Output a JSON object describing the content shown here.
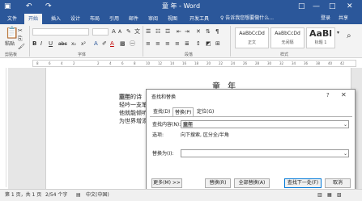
{
  "app": {
    "title": "童 年 - Word",
    "quick_access": {
      "save_icon": "save-icon",
      "undo_icon": "undo-icon",
      "redo_icon": "redo-icon"
    },
    "window_controls": {
      "restore_ribbon": "□",
      "minimize": "—",
      "maximize": "□",
      "close": "✕"
    }
  },
  "tabs": [
    "文件",
    "开始",
    "插入",
    "设计",
    "布局",
    "引用",
    "邮件",
    "审阅",
    "视图",
    "开发工具"
  ],
  "active_tab": 1,
  "tellme": "♀ 告诉我您想要做什么...",
  "account": {
    "signin": "登录",
    "share": "共享"
  },
  "ribbon": {
    "paste_label": "粘贴",
    "clipboard_label": "剪贴板",
    "font_label": "字体",
    "paragraph_label": "段落",
    "styles_label": "样式",
    "font_buttons": [
      "B",
      "I",
      "U",
      "abc",
      "x₂",
      "x²",
      "A",
      "A"
    ],
    "styles": [
      {
        "sample": "AaBbCcDd",
        "name": "正文"
      },
      {
        "sample": "AaBbCcDd",
        "name": "无间隔"
      },
      {
        "sample": "AaBl",
        "name": "标题 1"
      }
    ]
  },
  "ruler_ticks": [
    "8",
    "6",
    "4",
    "2",
    "",
    "2",
    "4",
    "6",
    "8",
    "10",
    "12",
    "14",
    "16",
    "18",
    "20",
    "22",
    "24",
    "26",
    "28",
    "30",
    "32",
    "34",
    "36",
    "38",
    "40",
    "42"
  ],
  "document": {
    "heading": "童 年",
    "lines": [
      {
        "pre": "",
        "highlight": "童年",
        "post": "的诗"
      },
      {
        "pre": "",
        "highlight": "",
        "post": "轻吟一支笔"
      },
      {
        "pre": "",
        "highlight": "",
        "post": "他就能倾听美丽的诗篇"
      },
      {
        "pre": "",
        "highlight": "",
        "post": "为世界增添美丽文学"
      }
    ]
  },
  "dialog": {
    "title": "查找和替换",
    "help": "?",
    "close": "✕",
    "tabs": [
      "查找(D)",
      "替换(P)",
      "定位(G)"
    ],
    "active_tab": 1,
    "find_label": "查找内容(N):",
    "find_value": "童年",
    "options_label": "选项:",
    "options_value": "向下搜索, 区分全/半角",
    "replace_label": "替换为(I):",
    "replace_value": "",
    "buttons": {
      "more": "更多(M) >>",
      "replace": "替换(R)",
      "replace_all": "全部替换(A)",
      "find_next": "查找下一处(F)",
      "cancel": "取消"
    }
  },
  "status": {
    "page": "第 1 页，共 1 页",
    "words": "2/54 个字",
    "lang": "中文(中国)"
  },
  "colors": {
    "accent": "#2b579a"
  }
}
